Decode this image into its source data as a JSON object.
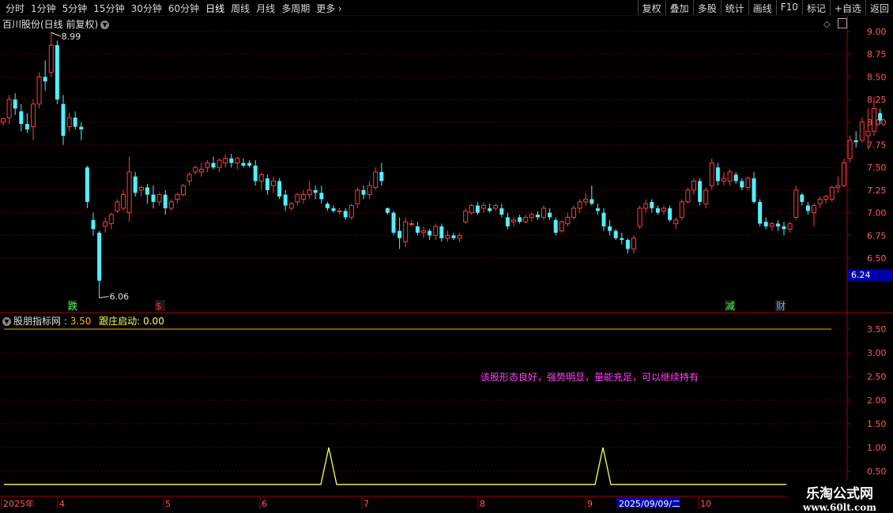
{
  "toolbar": {
    "periods": [
      "分时",
      "1分钟",
      "5分钟",
      "15分钟",
      "30分钟",
      "60分钟",
      "日线",
      "周线",
      "月线",
      "多周期",
      "更多"
    ],
    "active_period": "日线",
    "right_buttons": [
      "复权",
      "叠加",
      "多股",
      "统计",
      "画线",
      "F10",
      "标记",
      "+自选",
      "返回"
    ]
  },
  "main_panel": {
    "title": "百川股份(日线 前复权)",
    "high_marker": "8.99",
    "low_marker": "6.06",
    "current_price_box": "6.24",
    "y_ticks": [
      "9.00",
      "8.75",
      "8.50",
      "8.25",
      "8.00",
      "7.75",
      "7.50",
      "7.25",
      "7.00",
      "6.75",
      "6.50"
    ],
    "signal_labels": [
      {
        "text": "跌",
        "color": "#3cff3c"
      },
      {
        "text": "$",
        "color": "#ff3030"
      },
      {
        "text": "减",
        "color": "#3cff3c"
      },
      {
        "text": "财",
        "color": "#5aa0ff"
      }
    ]
  },
  "indicator_panel": {
    "name": "股朋指标网",
    "value1": "3.50",
    "label2": "跟庄启动",
    "value2": "0.00",
    "comment": "该股形态良好，强势明显，量能充足，可以继续持有",
    "y_ticks": [
      "3.50",
      "3.00",
      "2.50",
      "2.00",
      "1.50",
      "1.00",
      "0.50"
    ]
  },
  "date_axis": {
    "labels": [
      "2025年",
      "4",
      "5",
      "6",
      "7",
      "8",
      "9",
      "10"
    ],
    "highlight": "2025/09/09/二"
  },
  "watermark": {
    "line1": "乐淘公式网",
    "line2": "www.60lt.com"
  },
  "colors": {
    "up": "#ff3c3c",
    "down": "#4ff0ff",
    "grid": "#8b0000",
    "indicator_line": "#ffff50",
    "ref_line": "#ffb000",
    "comment": "#ff40ff"
  },
  "chart_data": {
    "type": "candlestick",
    "ylim": [
      6.06,
      9.1
    ],
    "candles": [
      [
        8.0,
        8.05,
        7.96,
        8.04
      ],
      [
        8.05,
        8.3,
        7.98,
        8.25
      ],
      [
        8.25,
        8.32,
        8.08,
        8.15
      ],
      [
        8.12,
        8.2,
        7.9,
        7.98
      ],
      [
        7.98,
        8.1,
        7.88,
        7.92
      ],
      [
        7.95,
        8.25,
        7.8,
        8.2
      ],
      [
        8.2,
        8.55,
        8.15,
        8.5
      ],
      [
        8.5,
        8.68,
        8.35,
        8.45
      ],
      [
        8.55,
        8.99,
        8.5,
        8.85
      ],
      [
        8.85,
        8.9,
        8.2,
        8.25
      ],
      [
        8.2,
        8.3,
        7.75,
        7.85
      ],
      [
        7.95,
        8.1,
        7.9,
        8.05
      ],
      [
        8.05,
        8.12,
        7.92,
        7.95
      ],
      [
        7.95,
        8.0,
        7.8,
        7.92
      ],
      [
        7.5,
        7.52,
        7.05,
        7.12
      ],
      [
        6.92,
        7.0,
        6.75,
        6.82
      ],
      [
        6.78,
        6.8,
        6.06,
        6.25
      ],
      [
        6.85,
        6.95,
        6.78,
        6.9
      ],
      [
        6.88,
        7.0,
        6.82,
        6.98
      ],
      [
        7.02,
        7.15,
        7.0,
        7.12
      ],
      [
        7.05,
        7.25,
        7.02,
        7.2
      ],
      [
        7.0,
        7.62,
        6.9,
        7.45
      ],
      [
        7.4,
        7.45,
        7.18,
        7.22
      ],
      [
        7.25,
        7.3,
        7.18,
        7.28
      ],
      [
        7.28,
        7.32,
        7.1,
        7.2
      ],
      [
        7.2,
        7.3,
        7.05,
        7.12
      ],
      [
        7.12,
        7.22,
        7.08,
        7.2
      ],
      [
        7.2,
        7.25,
        6.98,
        7.05
      ],
      [
        7.05,
        7.15,
        7.02,
        7.12
      ],
      [
        7.15,
        7.22,
        7.1,
        7.2
      ],
      [
        7.2,
        7.32,
        7.18,
        7.3
      ],
      [
        7.35,
        7.45,
        7.3,
        7.42
      ],
      [
        7.45,
        7.52,
        7.42,
        7.5
      ],
      [
        7.45,
        7.55,
        7.4,
        7.48
      ],
      [
        7.5,
        7.58,
        7.45,
        7.55
      ],
      [
        7.55,
        7.62,
        7.48,
        7.5
      ],
      [
        7.5,
        7.6,
        7.45,
        7.58
      ],
      [
        7.55,
        7.65,
        7.5,
        7.6
      ],
      [
        7.6,
        7.65,
        7.5,
        7.55
      ],
      [
        7.55,
        7.62,
        7.48,
        7.6
      ],
      [
        7.55,
        7.6,
        7.5,
        7.52
      ],
      [
        7.55,
        7.58,
        7.5,
        7.52
      ],
      [
        7.52,
        7.58,
        7.3,
        7.35
      ],
      [
        7.35,
        7.45,
        7.25,
        7.42
      ],
      [
        7.38,
        7.42,
        7.2,
        7.25
      ],
      [
        7.3,
        7.4,
        7.22,
        7.35
      ],
      [
        7.35,
        7.38,
        7.15,
        7.18
      ],
      [
        7.2,
        7.25,
        7.02,
        7.08
      ],
      [
        7.05,
        7.12,
        7.02,
        7.1
      ],
      [
        7.12,
        7.22,
        7.08,
        7.2
      ],
      [
        7.15,
        7.25,
        7.1,
        7.2
      ],
      [
        7.2,
        7.35,
        7.15,
        7.25
      ],
      [
        7.25,
        7.3,
        7.15,
        7.22
      ],
      [
        7.22,
        7.3,
        7.1,
        7.15
      ],
      [
        7.1,
        7.12,
        7.02,
        7.05
      ],
      [
        7.05,
        7.08,
        7.0,
        7.02
      ],
      [
        7.02,
        7.05,
        6.98,
        7.02
      ],
      [
        7.02,
        7.05,
        6.92,
        6.95
      ],
      [
        6.95,
        7.1,
        6.92,
        7.08
      ],
      [
        7.1,
        7.28,
        7.05,
        7.25
      ],
      [
        7.25,
        7.3,
        7.15,
        7.2
      ],
      [
        7.2,
        7.35,
        7.15,
        7.3
      ],
      [
        7.28,
        7.5,
        7.25,
        7.45
      ],
      [
        7.45,
        7.55,
        7.3,
        7.35
      ],
      [
        7.05,
        7.06,
        6.98,
        7.0
      ],
      [
        7.0,
        7.02,
        6.75,
        6.78
      ],
      [
        6.8,
        6.95,
        6.6,
        6.72
      ],
      [
        6.68,
        6.95,
        6.62,
        6.9
      ],
      [
        6.88,
        6.92,
        6.85,
        6.88
      ],
      [
        6.85,
        6.9,
        6.75,
        6.78
      ],
      [
        6.78,
        6.85,
        6.72,
        6.8
      ],
      [
        6.8,
        6.82,
        6.7,
        6.75
      ],
      [
        6.75,
        6.88,
        6.7,
        6.85
      ],
      [
        6.85,
        6.88,
        6.68,
        6.72
      ],
      [
        6.72,
        6.8,
        6.68,
        6.75
      ],
      [
        6.75,
        6.78,
        6.7,
        6.72
      ],
      [
        6.72,
        6.78,
        6.68,
        6.75
      ],
      [
        6.9,
        7.05,
        6.88,
        7.02
      ],
      [
        7.0,
        7.1,
        6.98,
        7.08
      ],
      [
        7.08,
        7.12,
        6.98,
        7.0
      ],
      [
        7.05,
        7.12,
        7.0,
        7.08
      ],
      [
        7.05,
        7.1,
        7.0,
        7.02
      ],
      [
        7.05,
        7.1,
        7.02,
        7.08
      ],
      [
        7.05,
        7.1,
        6.95,
        6.98
      ],
      [
        6.95,
        7.0,
        6.82,
        6.85
      ],
      [
        6.9,
        6.95,
        6.85,
        6.92
      ],
      [
        6.95,
        6.98,
        6.88,
        6.9
      ],
      [
        6.9,
        6.98,
        6.88,
        6.95
      ],
      [
        6.95,
        7.0,
        6.9,
        6.98
      ],
      [
        6.98,
        7.02,
        6.92,
        6.95
      ],
      [
        6.95,
        7.08,
        6.92,
        7.05
      ],
      [
        7.0,
        7.05,
        6.92,
        6.95
      ],
      [
        6.92,
        6.95,
        6.75,
        6.78
      ],
      [
        6.8,
        6.92,
        6.78,
        6.9
      ],
      [
        6.88,
        7.0,
        6.85,
        6.95
      ],
      [
        6.95,
        7.08,
        6.92,
        7.05
      ],
      [
        7.05,
        7.15,
        7.0,
        7.12
      ],
      [
        7.12,
        7.22,
        7.08,
        7.15
      ],
      [
        7.15,
        7.3,
        7.08,
        7.1
      ],
      [
        7.05,
        7.1,
        6.98,
        7.02
      ],
      [
        7.0,
        7.05,
        6.8,
        6.85
      ],
      [
        6.85,
        6.92,
        6.75,
        6.8
      ],
      [
        6.8,
        6.82,
        6.7,
        6.72
      ],
      [
        6.72,
        6.78,
        6.65,
        6.7
      ],
      [
        6.7,
        6.72,
        6.55,
        6.6
      ],
      [
        6.6,
        6.75,
        6.55,
        6.72
      ],
      [
        6.85,
        7.08,
        6.82,
        7.05
      ],
      [
        7.05,
        7.15,
        7.0,
        7.1
      ],
      [
        7.12,
        7.15,
        7.0,
        7.05
      ],
      [
        7.05,
        7.08,
        6.98,
        7.0
      ],
      [
        7.02,
        7.08,
        6.98,
        7.05
      ],
      [
        7.05,
        7.08,
        6.9,
        6.92
      ],
      [
        6.88,
        6.95,
        6.82,
        6.92
      ],
      [
        6.95,
        7.15,
        6.92,
        7.12
      ],
      [
        7.12,
        7.28,
        7.1,
        7.25
      ],
      [
        7.25,
        7.38,
        7.2,
        7.35
      ],
      [
        7.35,
        7.38,
        7.08,
        7.12
      ],
      [
        7.1,
        7.28,
        7.05,
        7.25
      ],
      [
        7.3,
        7.6,
        7.25,
        7.55
      ],
      [
        7.5,
        7.55,
        7.3,
        7.35
      ],
      [
        7.35,
        7.45,
        7.3,
        7.38
      ],
      [
        7.35,
        7.48,
        7.3,
        7.45
      ],
      [
        7.42,
        7.45,
        7.32,
        7.35
      ],
      [
        7.35,
        7.38,
        7.25,
        7.28
      ],
      [
        7.28,
        7.4,
        7.25,
        7.38
      ],
      [
        7.38,
        7.45,
        7.1,
        7.12
      ],
      [
        7.12,
        7.15,
        6.85,
        6.88
      ],
      [
        6.9,
        6.95,
        6.82,
        6.85
      ],
      [
        6.85,
        6.9,
        6.8,
        6.88
      ],
      [
        6.88,
        6.92,
        6.8,
        6.85
      ],
      [
        6.85,
        6.9,
        6.75,
        6.82
      ],
      [
        6.82,
        6.9,
        6.78,
        6.88
      ],
      [
        6.95,
        7.3,
        6.92,
        7.25
      ],
      [
        7.2,
        7.22,
        7.08,
        7.12
      ],
      [
        7.08,
        7.12,
        6.98,
        7.02
      ],
      [
        7.0,
        7.1,
        6.85,
        7.08
      ],
      [
        7.1,
        7.18,
        7.05,
        7.15
      ],
      [
        7.15,
        7.2,
        7.1,
        7.18
      ],
      [
        7.15,
        7.3,
        7.12,
        7.28
      ],
      [
        7.28,
        7.4,
        7.22,
        7.3
      ],
      [
        7.3,
        7.6,
        7.28,
        7.55
      ],
      [
        7.6,
        7.85,
        7.55,
        7.8
      ],
      [
        7.8,
        7.9,
        7.72,
        7.78
      ],
      [
        7.8,
        8.05,
        7.78,
        8.0
      ],
      [
        7.85,
        8.15,
        7.7,
        7.9
      ],
      [
        7.9,
        8.28,
        7.85,
        8.15
      ],
      [
        8.1,
        8.15,
        7.98,
        8.02
      ]
    ]
  }
}
